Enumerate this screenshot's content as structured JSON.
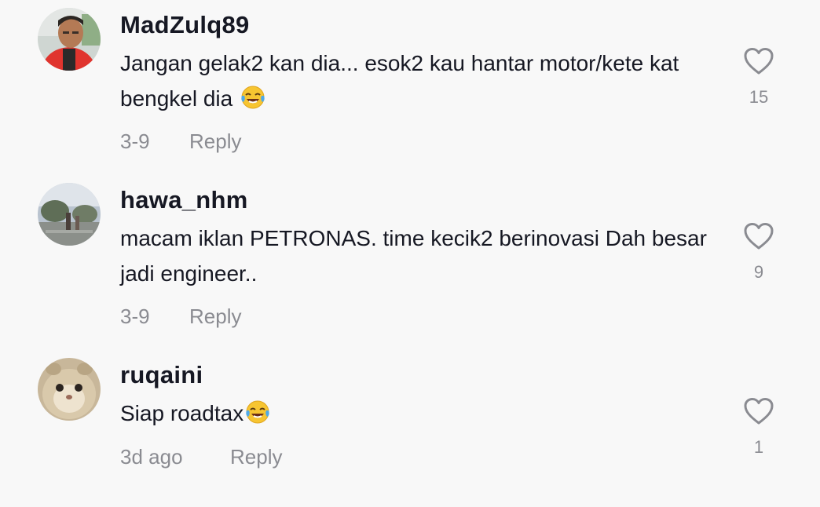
{
  "comments": [
    {
      "username": "MadZulq89",
      "text": "Jangan gelak2 kan dia... esok2 kau hantar motor/kete kat bengkel dia",
      "emoji": "face-with-tears-of-joy",
      "date": "3-9",
      "reply_label": "Reply",
      "likes": "15"
    },
    {
      "username": "hawa_nhm",
      "text": "macam iklan PETRONAS. time kecik2 berinovasi Dah besar jadi engineer..",
      "date": "3-9",
      "reply_label": "Reply",
      "likes": "9"
    },
    {
      "username": "ruqaini",
      "text": "Siap roadtax",
      "emoji": "face-with-tears-of-joy",
      "date": "3d ago",
      "reply_label": "Reply",
      "likes": "1"
    }
  ],
  "icons": {
    "like": "heart-outline-icon"
  },
  "colors": {
    "text": "#161823",
    "secondary": "#8a8b91",
    "background": "#f8f8f8"
  }
}
